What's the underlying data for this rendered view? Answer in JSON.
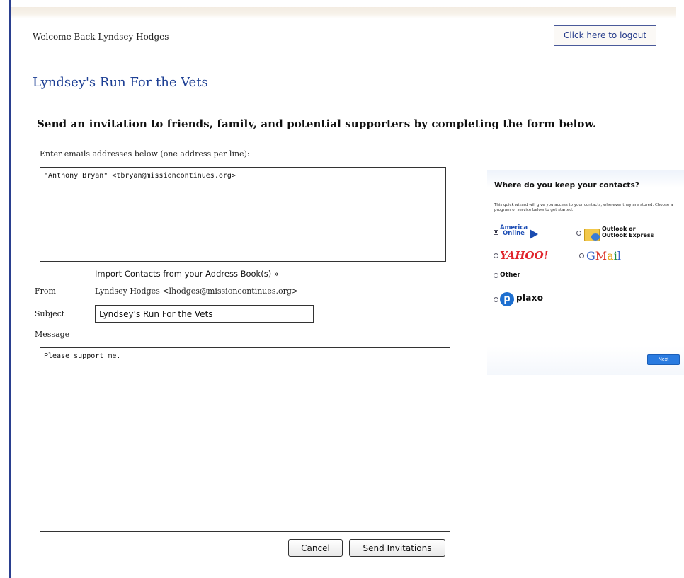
{
  "header": {
    "welcome_text": "Welcome Back Lyndsey Hodges",
    "logout_label": "Click here to logout"
  },
  "page": {
    "title": "Lyndsey's Run For the Vets",
    "headline": "Send an invitation to friends, family, and potential supporters by completing the form below."
  },
  "form": {
    "emails_label": "Enter emails addresses below (one address per line):",
    "emails_value": "\"Anthony Bryan\" <tbryan@missioncontinues.org>",
    "import_link": "Import Contacts from your Address Book(s) »",
    "from_label": "From",
    "from_value": "Lyndsey Hodges <lhodges@missioncontinues.org>",
    "subject_label": "Subject",
    "subject_value": "Lyndsey's Run For the Vets",
    "message_label": "Message",
    "message_value": "Please support me.",
    "cancel_label": "Cancel",
    "send_label": "Send Invitations"
  },
  "wizard": {
    "title": "Where do you keep your contacts?",
    "description": "This quick wizard will give you access to your contacts, wherever they are stored. Choose a program or service below to get started.",
    "options": {
      "aol": "America Online",
      "aol_line1": "America",
      "aol_line2": "Online",
      "outlook": "Outlook or Outlook Express",
      "outlook_line1": "Outlook or",
      "outlook_line2": "Outlook Express",
      "yahoo": "YAHOO!",
      "gmail": "GMail",
      "other": "Other",
      "plaxo": "plaxo"
    },
    "next_label": "Next"
  },
  "colors": {
    "title_blue": "#1d3f94",
    "link_blue": "#243a8a",
    "next_button": "#2a7be0",
    "yahoo_red": "#e0232a"
  }
}
